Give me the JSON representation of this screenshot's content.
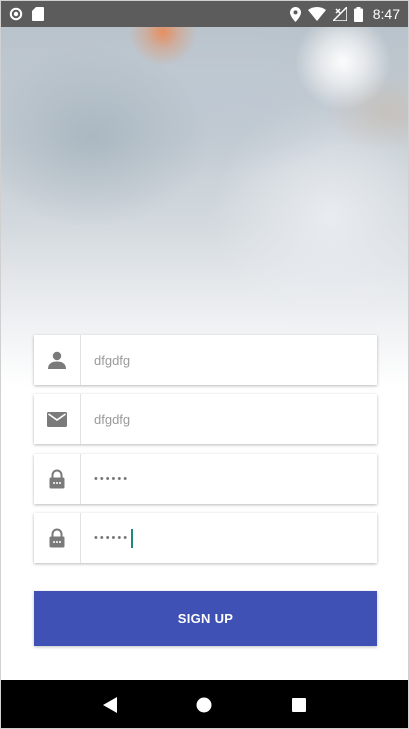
{
  "status_bar": {
    "time": "8:47",
    "icons": [
      "circle-notification-icon",
      "sd-card-icon",
      "location-icon",
      "wifi-icon",
      "no-signal-icon",
      "battery-icon"
    ]
  },
  "form": {
    "username": {
      "icon": "person-icon",
      "value": "dfgdfg"
    },
    "email": {
      "icon": "mail-icon",
      "value": "dfgdfg"
    },
    "password": {
      "icon": "lock-icon",
      "value": "••••••"
    },
    "confirm_password": {
      "icon": "lock-icon",
      "value": "••••••"
    }
  },
  "signup_button": {
    "label": "SIGN UP",
    "color": "#3f51b5"
  },
  "nav_bar": {
    "icons": [
      "back-icon",
      "home-icon",
      "recents-icon"
    ]
  }
}
